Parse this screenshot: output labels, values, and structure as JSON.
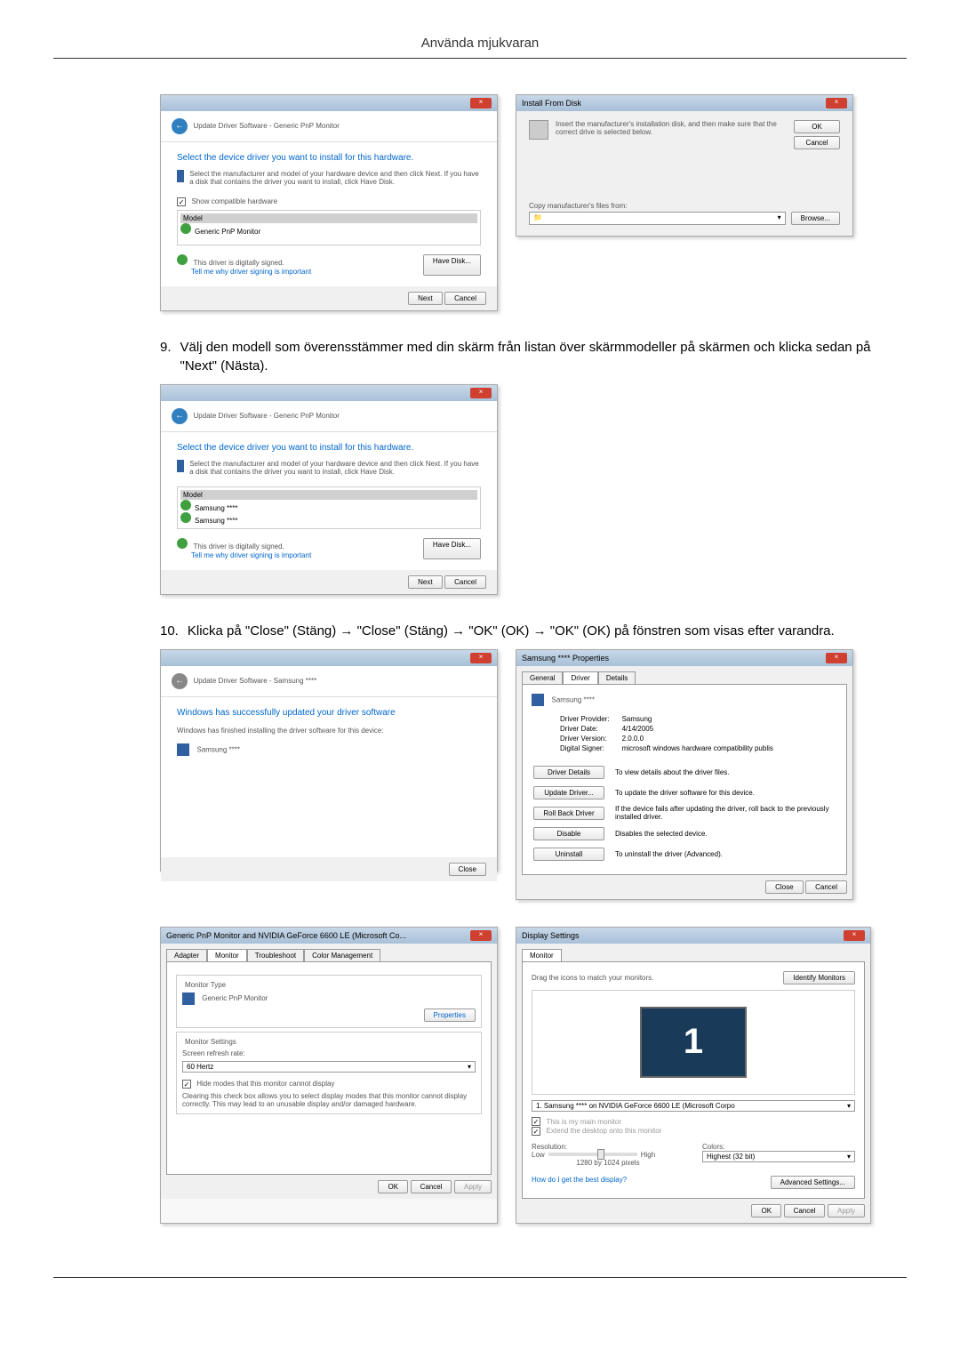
{
  "header": "Använda mjukvaran",
  "dialog1": {
    "title": "Update Driver Software - Generic PnP Monitor",
    "heading": "Select the device driver you want to install for this hardware.",
    "instruction": "Select the manufacturer and model of your hardware device and then click Next. If you have a disk that contains the driver you want to install, click Have Disk.",
    "show_compatible": "Show compatible hardware",
    "model_label": "Model",
    "model_item": "Generic PnP Monitor",
    "signed": "This driver is digitally signed.",
    "tell_me": "Tell me why driver signing is important",
    "have_disk": "Have Disk...",
    "next": "Next",
    "cancel": "Cancel"
  },
  "dialog2": {
    "title": "Install From Disk",
    "instruction": "Insert the manufacturer's installation disk, and then make sure that the correct drive is selected below.",
    "ok": "OK",
    "cancel": "Cancel",
    "copy_label": "Copy manufacturer's files from:",
    "browse": "Browse..."
  },
  "step9": {
    "num": "9.",
    "text": "Välj den modell som överensstämmer med din skärm från listan över skärmmodeller på skärmen och klicka sedan på \"Next\" (Nästa)."
  },
  "dialog3": {
    "title": "Update Driver Software - Generic PnP Monitor",
    "heading": "Select the device driver you want to install for this hardware.",
    "instruction": "Select the manufacturer and model of your hardware device and then click Next. If you have a disk that contains the driver you want to install, click Have Disk.",
    "model_label": "Model",
    "model_item1": "Samsung ****",
    "model_item2": "Samsung ****",
    "signed": "This driver is digitally signed.",
    "tell_me": "Tell me why driver signing is important",
    "have_disk": "Have Disk...",
    "next": "Next",
    "cancel": "Cancel"
  },
  "step10": {
    "num": "10.",
    "text": "Klicka på \"Close\" (Stäng) → \"Close\" (Stäng) → \"OK\" (OK) → \"OK\" (OK) på fönstren som visas efter varandra."
  },
  "dialog4": {
    "title": "Update Driver Software - Samsung ****",
    "heading": "Windows has successfully updated your driver software",
    "sub": "Windows has finished installing the driver software for this device:",
    "device": "Samsung ****",
    "close": "Close"
  },
  "dialog5": {
    "title": "Samsung **** Properties",
    "tab_general": "General",
    "tab_driver": "Driver",
    "tab_details": "Details",
    "device": "Samsung ****",
    "provider_label": "Driver Provider:",
    "provider_val": "Samsung",
    "date_label": "Driver Date:",
    "date_val": "4/14/2005",
    "version_label": "Driver Version:",
    "version_val": "2.0.0.0",
    "signer_label": "Digital Signer:",
    "signer_val": "microsoft windows hardware compatibility publis",
    "btn_details": "Driver Details",
    "txt_details": "To view details about the driver files.",
    "btn_update": "Update Driver...",
    "txt_update": "To update the driver software for this device.",
    "btn_rollback": "Roll Back Driver",
    "txt_rollback": "If the device fails after updating the driver, roll back to the previously installed driver.",
    "btn_disable": "Disable",
    "txt_disable": "Disables the selected device.",
    "btn_uninstall": "Uninstall",
    "txt_uninstall": "To uninstall the driver (Advanced).",
    "close": "Close",
    "cancel": "Cancel"
  },
  "dialog6": {
    "title": "Generic PnP Monitor and NVIDIA GeForce 6600 LE (Microsoft Co...",
    "tab_adapter": "Adapter",
    "tab_monitor": "Monitor",
    "tab_troubleshoot": "Troubleshoot",
    "tab_color": "Color Management",
    "monitor_type": "Monitor Type",
    "monitor_name": "Generic PnP Monitor",
    "properties": "Properties",
    "monitor_settings": "Monitor Settings",
    "refresh_label": "Screen refresh rate:",
    "refresh_val": "60 Hertz",
    "hide_modes": "Hide modes that this monitor cannot display",
    "hide_desc": "Clearing this check box allows you to select display modes that this monitor cannot display correctly. This may lead to an unusable display and/or damaged hardware.",
    "ok": "OK",
    "cancel": "Cancel",
    "apply": "Apply"
  },
  "dialog7": {
    "title": "Display Settings",
    "tab_monitor": "Monitor",
    "drag_text": "Drag the icons to match your monitors.",
    "identify": "Identify Monitors",
    "monitor_num": "1",
    "device_select": "1. Samsung **** on NVIDIA GeForce 6600 LE (Microsoft Corpo",
    "main_monitor": "This is my main monitor",
    "extend": "Extend the desktop onto this monitor",
    "resolution": "Resolution:",
    "low": "Low",
    "high": "High",
    "res_val": "1280 by 1024 pixels",
    "colors": "Colors:",
    "color_val": "Highest (32 bit)",
    "best_display": "How do I get the best display?",
    "advanced": "Advanced Settings...",
    "ok": "OK",
    "cancel": "Cancel",
    "apply": "Apply"
  }
}
